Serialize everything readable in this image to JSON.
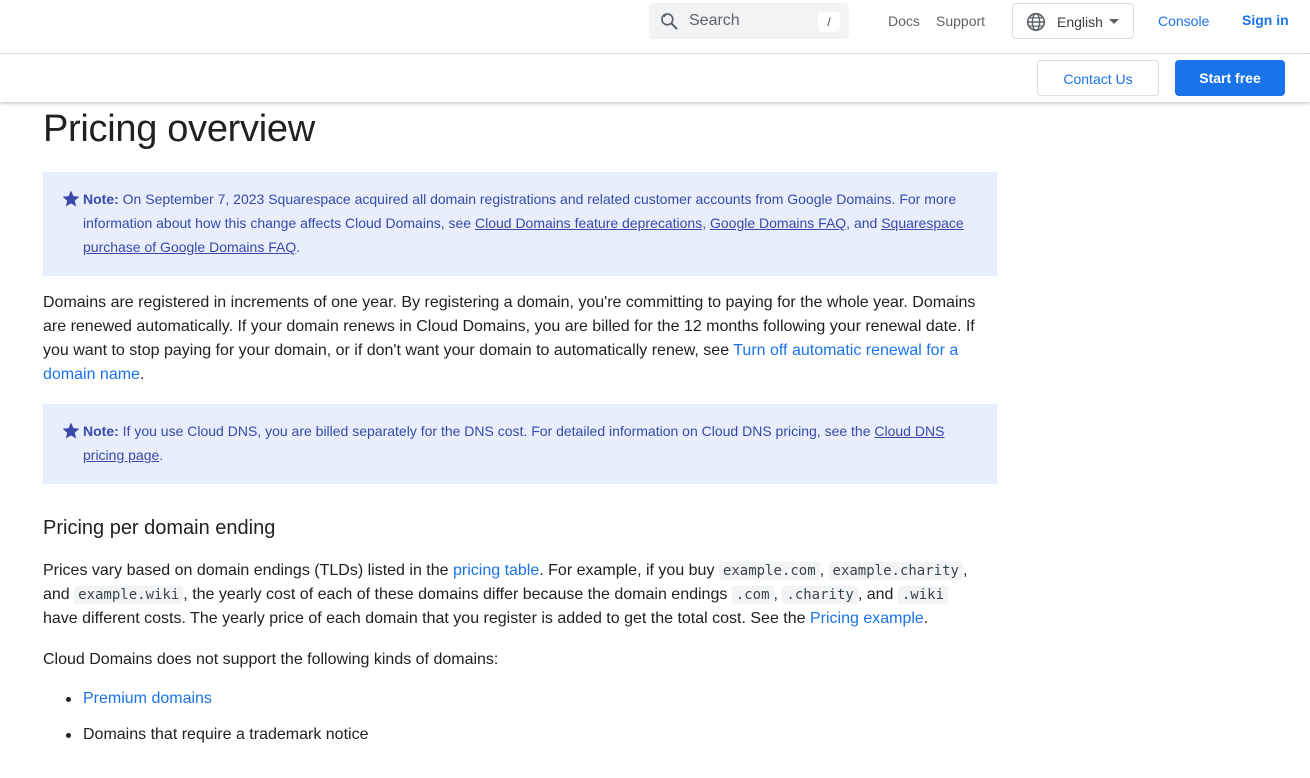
{
  "header": {
    "search_placeholder": "Search",
    "search_shortcut": "/",
    "docs": "Docs",
    "support": "Support",
    "language": "English",
    "console": "Console",
    "signin": "Sign in"
  },
  "subbar": {
    "contact": "Contact Us",
    "start_free": "Start free"
  },
  "page": {
    "title": "Pricing overview",
    "note1": {
      "label": "Note:",
      "text1": " On September 7, 2023 Squarespace acquired all domain registrations and related customer accounts from Google Domains. For more information about how this change affects Cloud Domains, see ",
      "link1": "Cloud Domains feature deprecations",
      "sep1": ", ",
      "link2": "Google Domains FAQ",
      "sep2": ", and ",
      "link3": "Squarespace purchase of Google Domains FAQ",
      "end": "."
    },
    "para1": {
      "text": "Domains are registered in increments of one year. By registering a domain, you're committing to paying for the whole year. Domains are renewed automatically. If your domain renews in Cloud Domains, you are billed for the 12 months following your renewal date. If you want to stop paying for your domain, or if don't want your domain to automatically renew, see ",
      "link": "Turn off automatic renewal for a domain name",
      "end": "."
    },
    "note2": {
      "label": "Note:",
      "text": " If you use Cloud DNS, you are billed separately for the DNS cost. For detailed information on Cloud DNS pricing, see the ",
      "link": "Cloud DNS pricing page",
      "end": "."
    },
    "section_title": "Pricing per domain ending",
    "para2": {
      "t1": "Prices vary based on domain endings (TLDs) listed in the ",
      "link1": "pricing table",
      "t2": ". For example, if you buy ",
      "c1": "example.com",
      "t3": ", ",
      "c2": "example.charity",
      "t4": ", and ",
      "c3": "example.wiki",
      "t5": ", the yearly cost of each of these domains differ because the domain endings ",
      "c4": ".com",
      "t6": ", ",
      "c5": ".charity",
      "t7": ", and ",
      "c6": ".wiki",
      "t8": " have different costs. The yearly price of each domain that you register is added to get the total cost. See the ",
      "link2": "Pricing example",
      "t9": "."
    },
    "para3": "Cloud Domains does not support the following kinds of domains:",
    "list": {
      "item1": "Premium domains",
      "item2": "Domains that require a trademark notice"
    }
  },
  "colors": {
    "accent": "#1a73e8",
    "note_bg": "#e8eefc",
    "note_text": "#3949ab"
  },
  "icons": [
    "search-icon",
    "globe-icon",
    "chevron-down-icon",
    "star-icon"
  ]
}
